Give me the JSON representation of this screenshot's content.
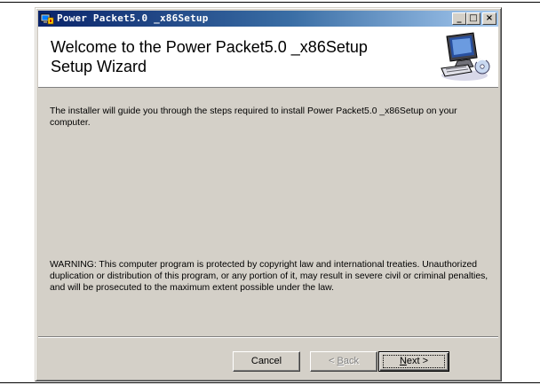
{
  "window": {
    "title": "Power Packet5.0 _x86Setup",
    "controls": {
      "minimize": "_",
      "maximize": "□",
      "close": "×"
    }
  },
  "header": {
    "heading": "Welcome to the Power Packet5.0 _x86Setup Setup Wizard",
    "icon": "setup-computer-icon"
  },
  "body": {
    "intro": "The installer will guide you through the steps required to install Power Packet5.0 _x86Setup on your computer.",
    "warning": "WARNING: This computer program is protected by copyright law and international treaties. Unauthorized duplication or distribution of this program, or any portion of it, may result in severe civil or criminal penalties, and will be prosecuted to the maximum extent possible under the law."
  },
  "buttons": {
    "cancel": "Cancel",
    "back_prefix": "< ",
    "back_accel": "B",
    "back_rest": "ack",
    "next_accel": "N",
    "next_rest": "ext >"
  },
  "colors": {
    "face": "#d4d0c8",
    "title_start": "#0a246a",
    "title_end": "#a6caf0"
  }
}
